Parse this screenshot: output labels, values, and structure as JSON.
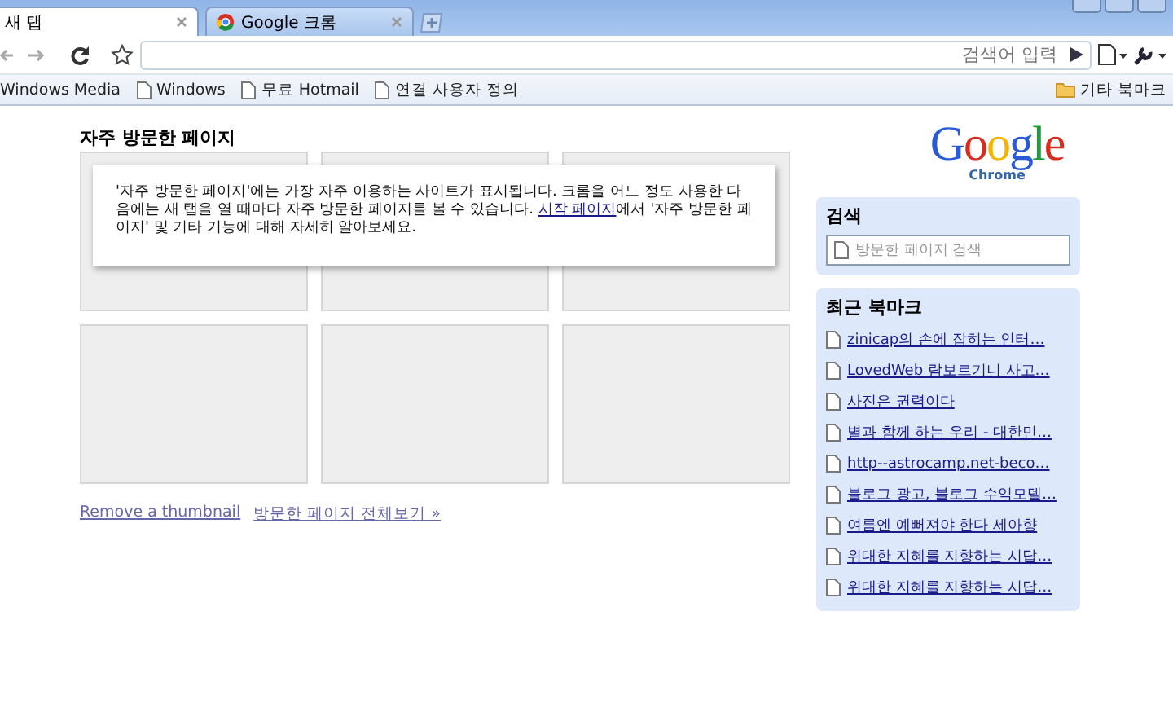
{
  "tabs": [
    {
      "label": "새 탭",
      "selected": true,
      "kind": "page"
    },
    {
      "label": "Google 크롬",
      "selected": false,
      "kind": "chrome"
    }
  ],
  "toolbar": {
    "search_hint": "검색어 입력"
  },
  "bookmarks_bar": {
    "items": [
      "Windows Media",
      "Windows",
      "무료 Hotmail",
      "연결 사용자 정의"
    ],
    "other": "기타 북마크"
  },
  "most_visited": {
    "title": "자주 방문한 페이지",
    "notice": {
      "text_before": "'자주 방문한 페이지'에는 가장 자주 이용하는 사이트가 표시됩니다. 크롬을 어느 정도 사용한 다음에는 새 탭을 열 때마다 자주 방문한 페이지를 볼 수 있습니다. ",
      "link": "시작 페이지",
      "text_after": "에서 '자주 방문한 페이지' 및 기타 기능에 대해 자세히 알아보세요."
    },
    "links": [
      "Remove a thumbnail",
      "방문한 페이지 전체보기 »"
    ]
  },
  "logo": {
    "word": "Google",
    "sub": "Chrome"
  },
  "search": {
    "title": "검색",
    "placeholder": "방문한 페이지 검색"
  },
  "recent_bookmarks": {
    "title": "최근 북마크",
    "items": [
      "zinicap의 손에 잡히는 인터…",
      "LovedWeb 람보르기니 사고…",
      "사진은 권력이다",
      "별과 함께 하는 우리 - 대한민…",
      "http--astrocamp.net-beco…",
      "블로그 광고, 블로그 수익모델…",
      "여름엔 예뻐져야 한다 세아향",
      "위대한 지혜를 지향하는 시답…",
      "위대한 지혜를 지향하는 시답…"
    ]
  }
}
